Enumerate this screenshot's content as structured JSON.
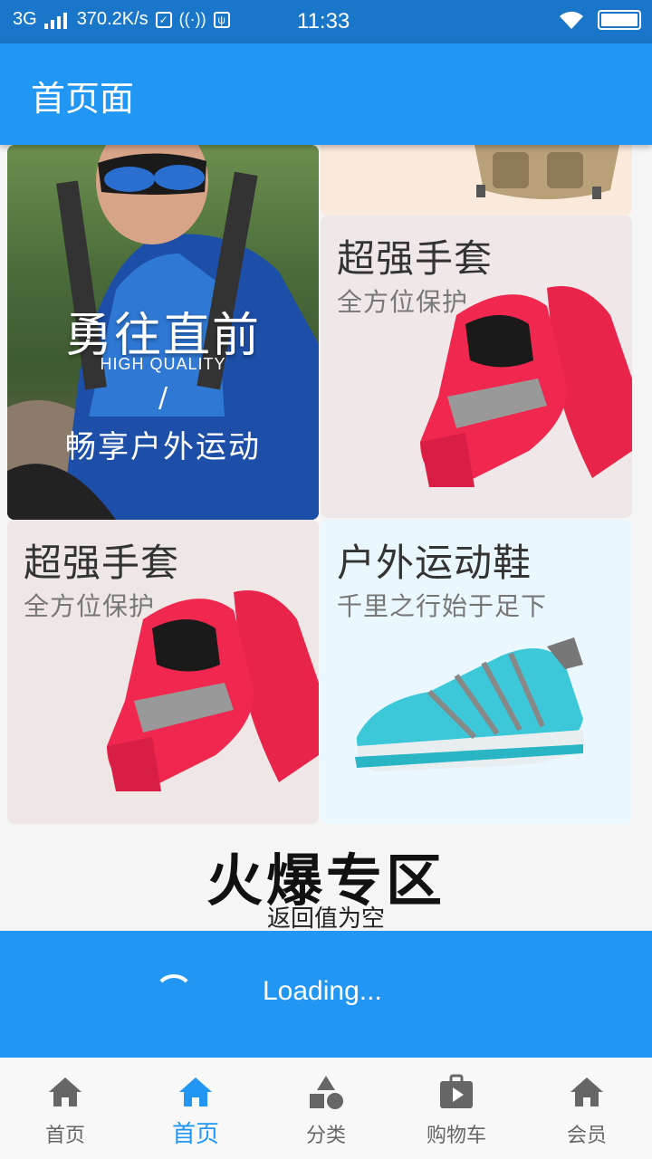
{
  "status_bar": {
    "network": "3G",
    "speed": "370.2K/s",
    "time": "11:33"
  },
  "app_bar": {
    "title": "首页面"
  },
  "tiles": {
    "hero": {
      "headline": "勇往直前",
      "quality": "HIGH QUALITY",
      "slash": "/",
      "tagline": "畅享户外运动"
    },
    "glove_1": {
      "title": "超强手套",
      "subtitle": "全方位保护"
    },
    "glove_2": {
      "title": "超强手套",
      "subtitle": "全方位保护"
    },
    "shoe": {
      "title": "户外运动鞋",
      "subtitle": "千里之行始于足下"
    }
  },
  "section": {
    "title": "火爆专区",
    "message": "返回值为空"
  },
  "loading": {
    "text": "Loading..."
  },
  "bottom_nav": {
    "items": [
      {
        "label": "首页",
        "icon": "home-icon",
        "active": false
      },
      {
        "label": "首页",
        "icon": "home-icon",
        "active": true
      },
      {
        "label": "分类",
        "icon": "shapes-icon",
        "active": false
      },
      {
        "label": "购物车",
        "icon": "shopping-bag-play-icon",
        "active": false
      },
      {
        "label": "会员",
        "icon": "home-icon",
        "active": false
      }
    ]
  },
  "colors": {
    "primary": "#2196f3",
    "status_bar": "#1a76c9",
    "nav_inactive": "#666666"
  }
}
